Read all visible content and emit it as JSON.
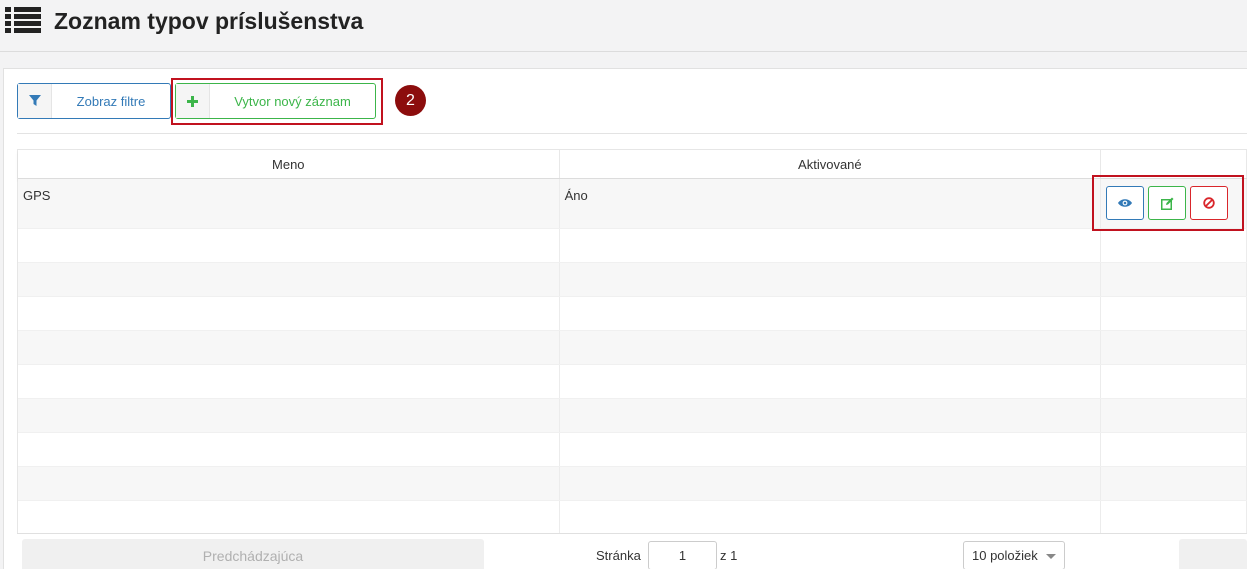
{
  "header": {
    "title": "Zoznam typov príslušenstva",
    "icon": "list-icon"
  },
  "toolbar": {
    "filter_label": "Zobraz filtre",
    "filter_icon": "filter-icon",
    "create_label": "Vytvor nový záznam",
    "create_icon": "plus-icon",
    "step_number": "2"
  },
  "table": {
    "columns": [
      "Meno",
      "Aktivované",
      ""
    ],
    "rows": [
      {
        "name": "GPS",
        "active": "Áno",
        "actions": [
          "eye-icon",
          "edit-icon",
          "ban-icon"
        ]
      }
    ],
    "empty_rows": 9
  },
  "pagination": {
    "prev_label": "Predchádzajúca",
    "page_label": "Stránka",
    "page_value": "1",
    "of_label": "z 1",
    "page_size_label": "10 položiek"
  },
  "colors": {
    "primary": "#337ab7",
    "success": "#3cb54a",
    "danger": "#d9262b",
    "highlight": "#c1121f",
    "badge": "#8c0d0d"
  }
}
